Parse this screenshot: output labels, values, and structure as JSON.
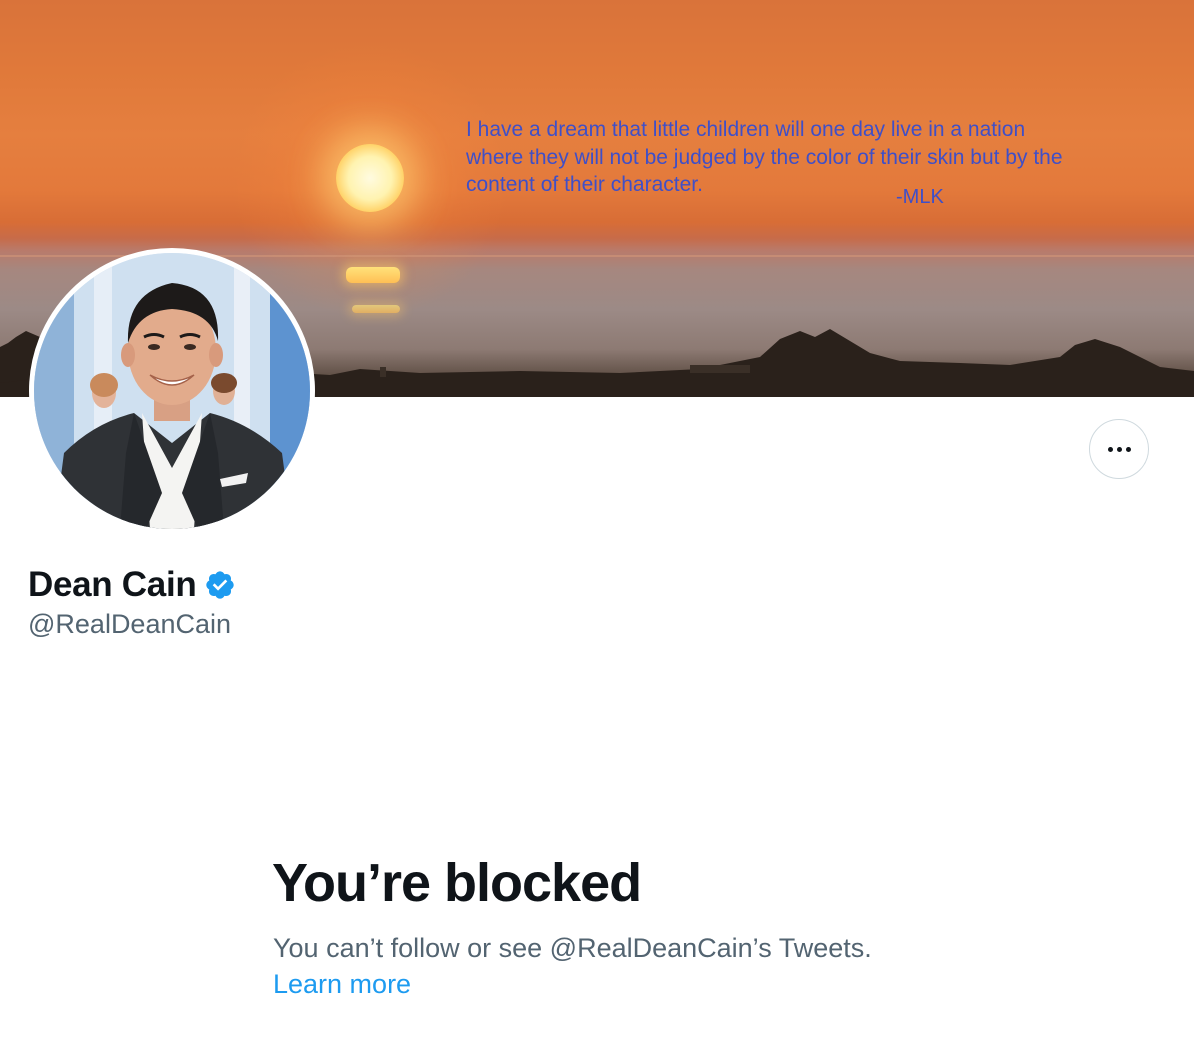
{
  "banner": {
    "quote": "I have a dream that little children will one day live in a nation where they will not be judged by the color of their skin but by the content of their character.",
    "attribution": "-MLK"
  },
  "profile": {
    "display_name": "Dean Cain",
    "handle": "@RealDeanCain",
    "verified": true,
    "verified_icon": "verified-badge-icon",
    "more_icon": "more-options-icon"
  },
  "blocked": {
    "title": "You’re blocked",
    "description": "You can’t follow or see @RealDeanCain’s Tweets.",
    "learn_more": "Learn more"
  },
  "colors": {
    "text_primary": "#0f1419",
    "text_secondary": "#536471",
    "link": "#1d9bf0",
    "verified": "#1d9bf0",
    "border": "#cfd9de",
    "quote_text": "#3f4fc8"
  }
}
